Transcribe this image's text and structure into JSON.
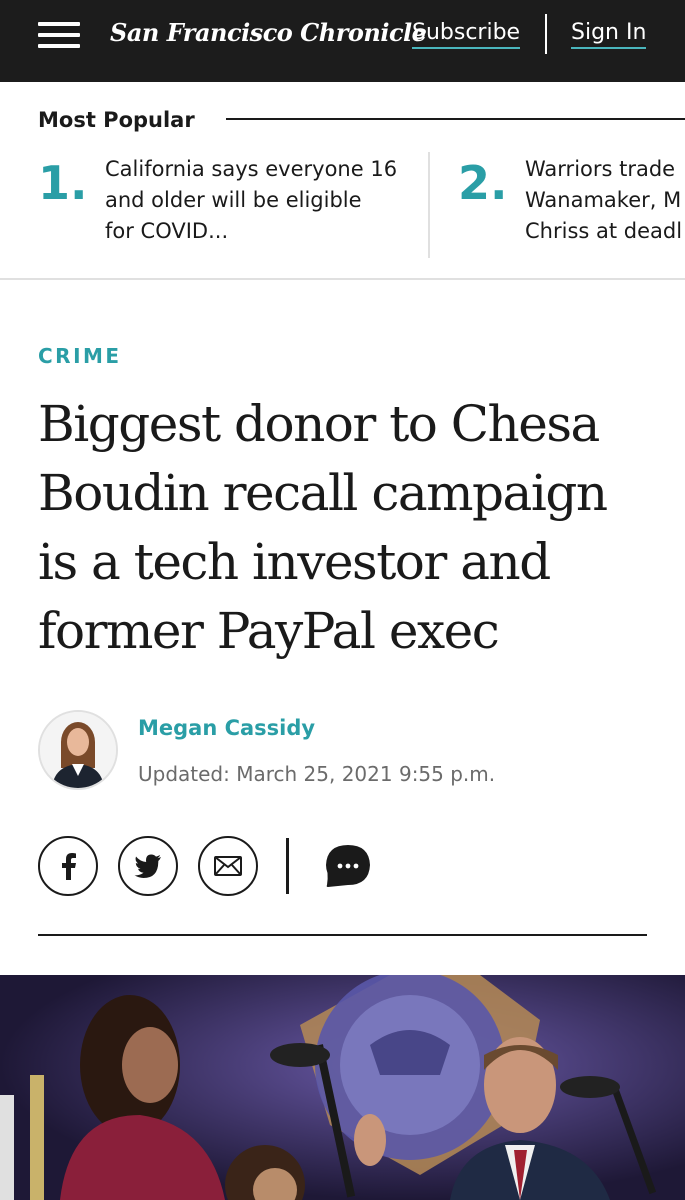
{
  "header": {
    "logo": "San Francisco Chronicle",
    "subscribe_label": "Subscribe",
    "signin_label": "Sign In"
  },
  "most_popular": {
    "title": "Most Popular",
    "items": [
      {
        "rank": "1.",
        "text": "California says everyone 16\nand older will be eligible\nfor COVID..."
      },
      {
        "rank": "2.",
        "text": "Warriors trade\nWanamaker, M\nChriss at deadl"
      }
    ]
  },
  "article": {
    "section": "CRIME",
    "headline": "Biggest donor to Chesa\nBoudin recall campaign\nis a tech investor and\nformer PayPal exec",
    "author": "Megan Cassidy",
    "updated": "Updated: March 25, 2021 9:55 p.m."
  },
  "share": {
    "icons": [
      "facebook-icon",
      "twitter-icon",
      "email-icon",
      "comment-icon"
    ]
  },
  "colors": {
    "accent": "#2a9ea6",
    "header_bg": "#1c1c1c",
    "underline": "#4ab6bd"
  }
}
